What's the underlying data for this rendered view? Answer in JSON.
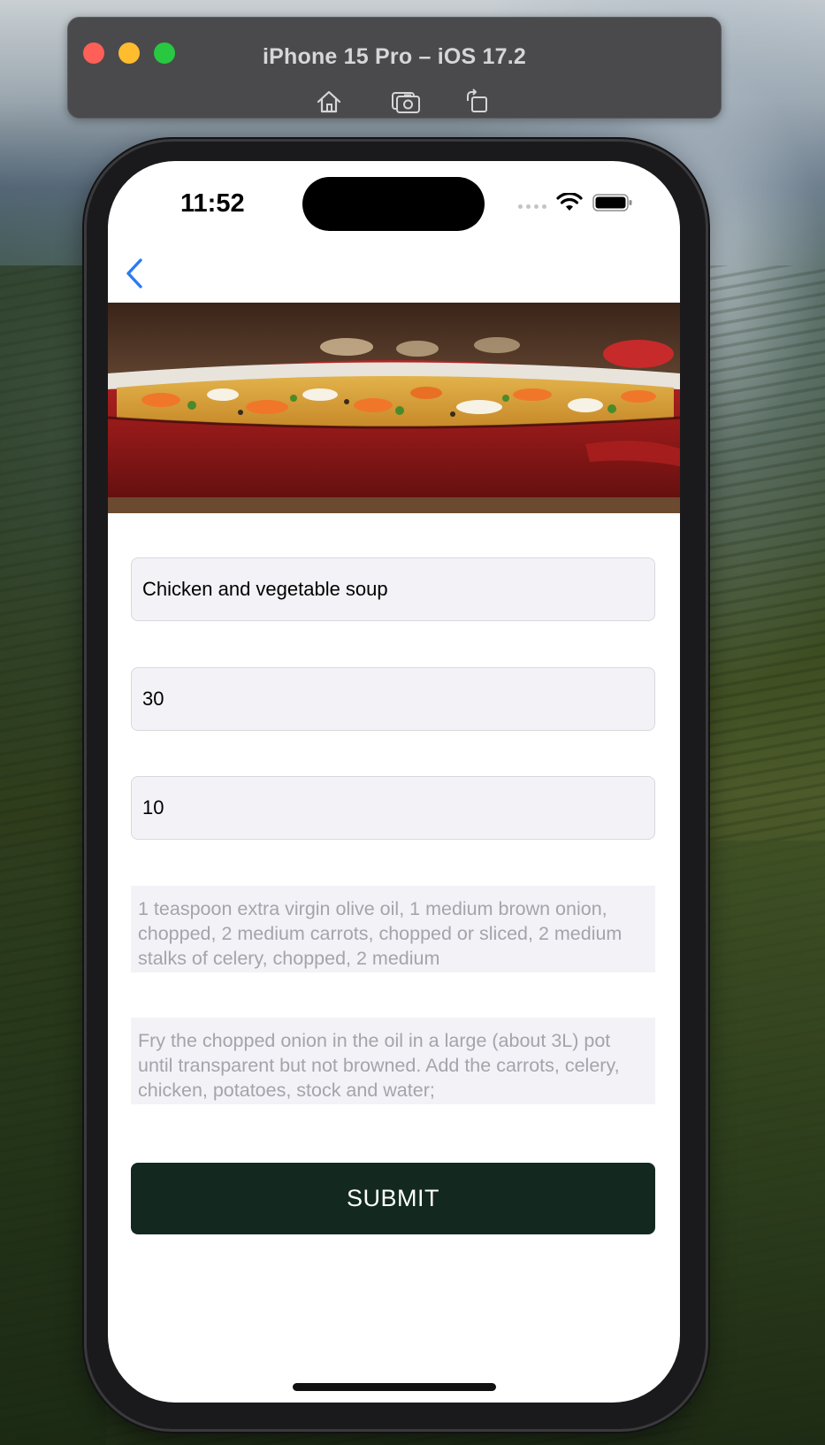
{
  "simulator": {
    "title": "iPhone 15 Pro – iOS 17.2",
    "tools": [
      {
        "icon": "home-icon"
      },
      {
        "icon": "screenshot-icon"
      },
      {
        "icon": "rotate-icon"
      }
    ]
  },
  "status_bar": {
    "time": "11:52",
    "icons": [
      "signal-dots-icon",
      "wifi-icon",
      "battery-icon"
    ]
  },
  "nav": {
    "back_icon": "chevron-left-icon",
    "accent_color": "#2b7bf0"
  },
  "hero_image": {
    "subject": "bowl of chicken and vegetable soup in a red pot"
  },
  "form": {
    "name_value": "Chicken and vegetable soup",
    "prep_time_value": "30",
    "servings_value": "10",
    "ingredients_text": "1 teaspoon extra virgin olive oil, 1 medium brown onion, chopped, 2 medium carrots, chopped or sliced, 2 medium stalks of celery, chopped, 2 medium",
    "method_text": "Fry the chopped onion in the oil in a large (about 3L) pot until transparent but not browned. Add the carrots, celery, chicken, potatoes, stock and water;",
    "submit_label": "SUBMIT",
    "submit_color": "#132920"
  }
}
